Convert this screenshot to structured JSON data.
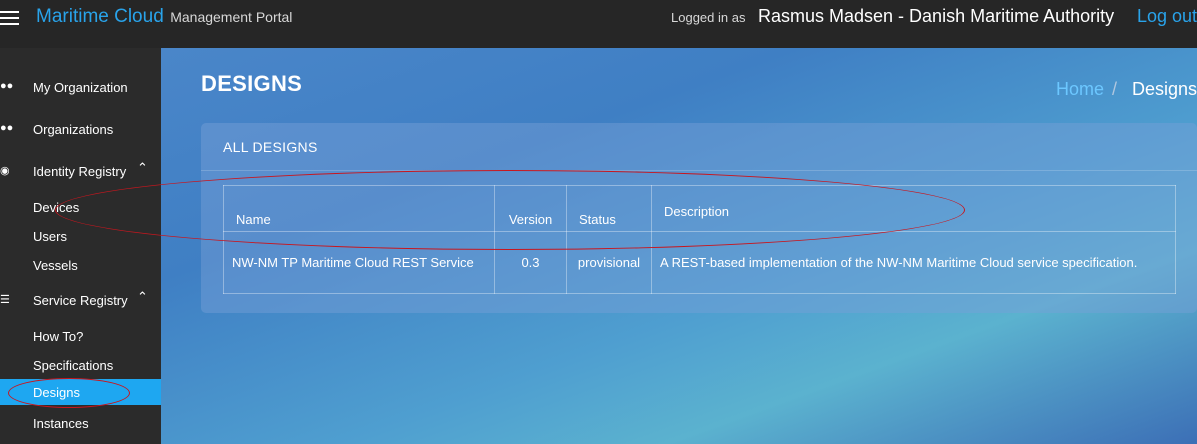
{
  "header": {
    "brand_main": "Maritime Cloud",
    "brand_sub": "Management Portal",
    "login_label": "Logged in as",
    "user": "Rasmus Madsen - Danish Maritime Authority",
    "logout": "Log out"
  },
  "sidebar": {
    "items": [
      {
        "label": "My Organization",
        "icon": "org-icon"
      },
      {
        "label": "Organizations",
        "icon": "orgs-icon"
      },
      {
        "label": "Identity Registry",
        "icon": "identity-icon"
      },
      {
        "label": "Devices"
      },
      {
        "label": "Users"
      },
      {
        "label": "Vessels"
      },
      {
        "label": "Service Registry",
        "icon": "layers-icon"
      },
      {
        "label": "How To?"
      },
      {
        "label": "Specifications"
      },
      {
        "label": "Designs",
        "active": true
      },
      {
        "label": "Instances"
      }
    ]
  },
  "page": {
    "title": "DESIGNS",
    "breadcrumb": {
      "home": "Home",
      "separator": "/",
      "current": "Designs"
    }
  },
  "panel": {
    "title": "ALL DESIGNS",
    "columns": [
      "Name",
      "Version",
      "Status",
      "Description"
    ],
    "rows": [
      {
        "name": "NW-NM TP Maritime Cloud REST Service",
        "version": "0.3",
        "status": "provisional",
        "description": "A REST-based implementation of the NW-NM Maritime Cloud service specification."
      }
    ]
  },
  "colors": {
    "accent": "#29a3ea",
    "active_nav": "#1ea7f1",
    "annotation": "#c8161e"
  }
}
